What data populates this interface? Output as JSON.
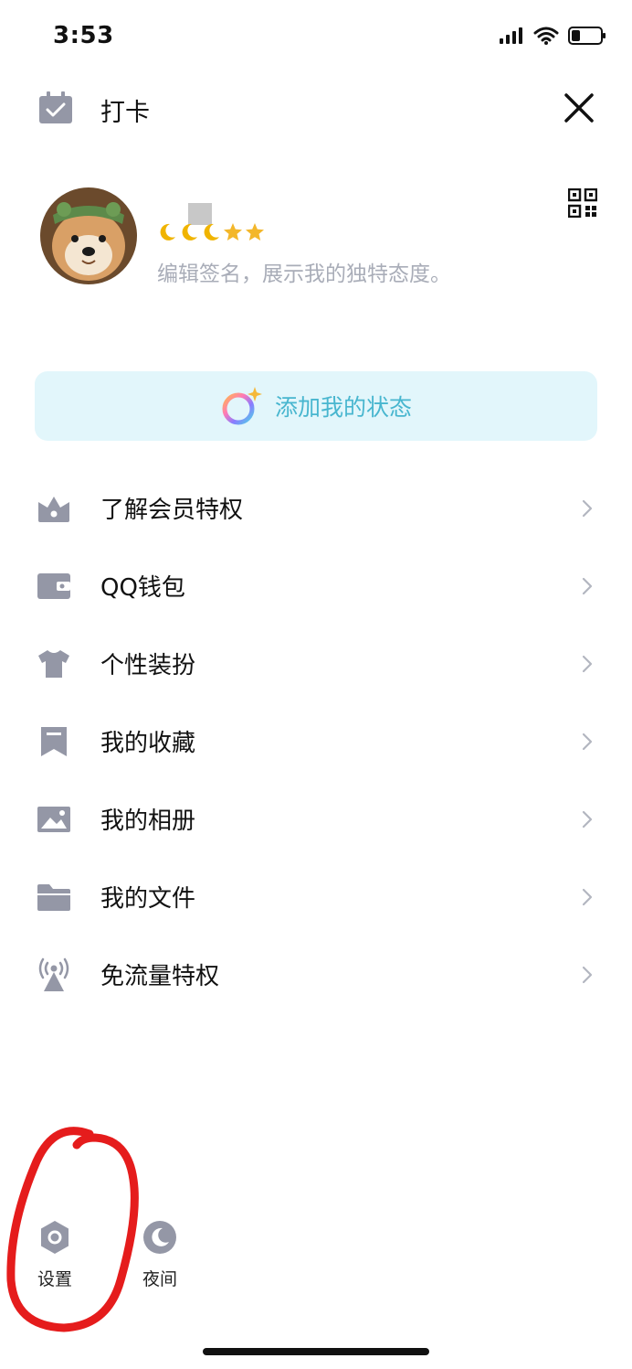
{
  "status_bar": {
    "time": "3:53"
  },
  "header": {
    "checkin_label": "打卡"
  },
  "profile": {
    "signature_placeholder": "编辑签名，展示我的独特态度。",
    "level_badges": [
      "moon-icon",
      "moon-icon",
      "moon-icon",
      "star-icon",
      "star-icon"
    ]
  },
  "status_pill": {
    "label": "添加我的状态"
  },
  "menu": {
    "items": [
      {
        "label": "了解会员特权",
        "icon": "crown-icon"
      },
      {
        "label": "QQ钱包",
        "icon": "wallet-icon"
      },
      {
        "label": "个性装扮",
        "icon": "shirt-icon"
      },
      {
        "label": "我的收藏",
        "icon": "bookmark-icon"
      },
      {
        "label": "我的相册",
        "icon": "photo-icon"
      },
      {
        "label": "我的文件",
        "icon": "folder-icon"
      },
      {
        "label": "免流量特权",
        "icon": "signal-tower-icon"
      }
    ]
  },
  "bottom": {
    "settings_label": "设置",
    "night_label": "夜间"
  },
  "colors": {
    "icon_gray": "#9497a6",
    "accent_cyan": "#48b6cf",
    "pill_bg": "#e2f6fb",
    "signature_gray": "#a9adb8",
    "annotation_red": "#e51c1c"
  }
}
